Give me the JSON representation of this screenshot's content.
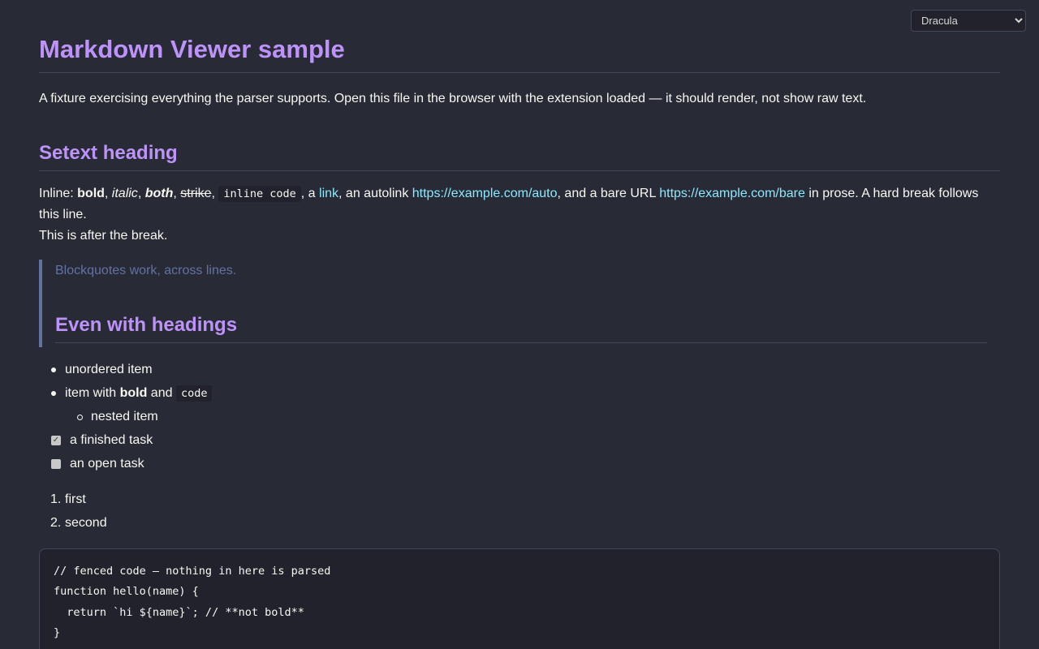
{
  "theme_select": {
    "value": "Dracula",
    "options": [
      "Dracula"
    ]
  },
  "doc": {
    "title": "Markdown Viewer sample",
    "intro": "A fixture exercising everything the parser supports. Open this file in the browser with the extension loaded — it should render, not show raw text.",
    "setext_heading": "Setext heading",
    "inline": {
      "prefix": "Inline: ",
      "bold": "bold",
      "sep1": ", ",
      "italic": "italic",
      "sep2": ", ",
      "both": "both",
      "sep3": ", ",
      "strike": "strike",
      "sep4": ", ",
      "code": "inline code",
      "sep5": ", a ",
      "link": "link",
      "sep6": ", an autolink ",
      "autolink": "https://example.com/auto",
      "sep7": ", and a bare URL ",
      "bare_url": "https://example.com/bare",
      "suffix": " in prose. A hard break follows this line.",
      "after_break": "This is after the break."
    },
    "blockquote": {
      "text": "Blockquotes work, across lines.",
      "heading": "Even with headings"
    },
    "unordered": {
      "item1": "unordered item",
      "item2_prefix": "item with ",
      "item2_bold": "bold",
      "item2_mid": " and ",
      "item2_code": "code",
      "nested": "nested item"
    },
    "tasks": [
      {
        "label": "a finished task",
        "done": true,
        "mark": "✓"
      },
      {
        "label": "an open task",
        "done": false,
        "mark": ""
      }
    ],
    "ordered": [
      {
        "num": "1.",
        "label": "first"
      },
      {
        "num": "2.",
        "label": "second"
      }
    ],
    "code_block": [
      "// fenced code — nothing in here is parsed",
      "function hello(name) {",
      "  return `hi ${name}`; // **not bold**",
      "}"
    ]
  }
}
